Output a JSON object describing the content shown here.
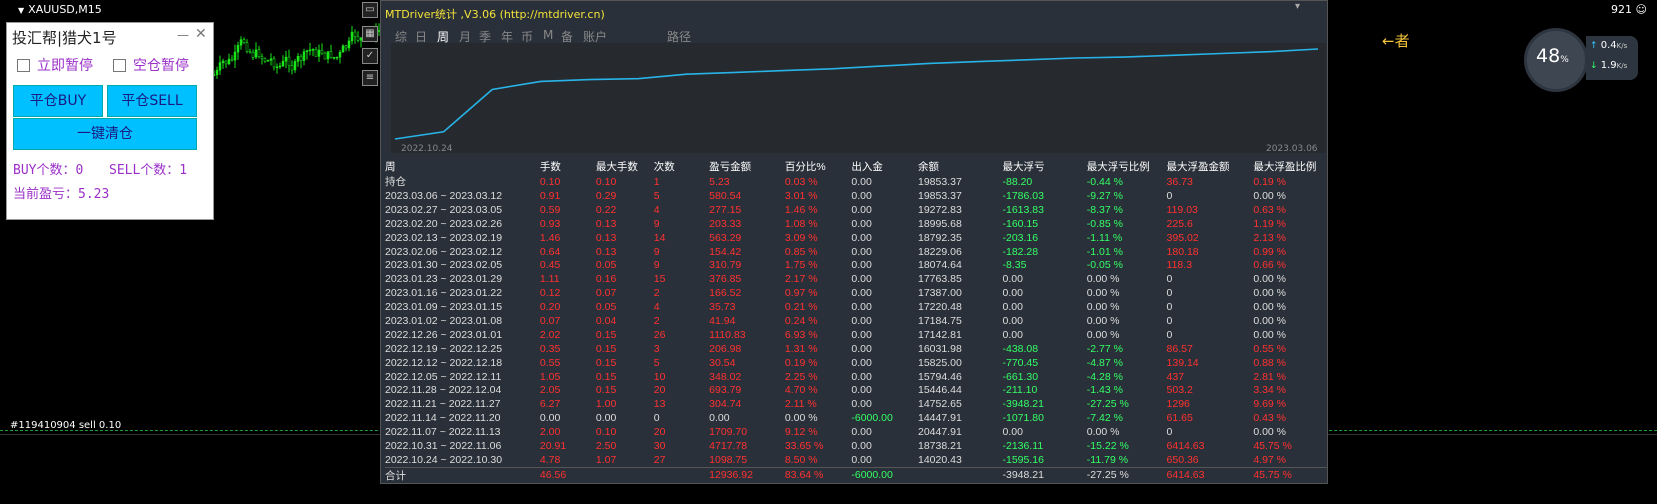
{
  "chart": {
    "symbol": "XAUUSD,M15",
    "order_label": "#119410904 sell 0.10",
    "score": "921"
  },
  "panel": {
    "title": "投汇帮|猎犬1号",
    "chk_pause_now": "立即暂停",
    "chk_pause_empty": "空仓暂停",
    "btn_close_buy": "平仓BUY",
    "btn_close_sell": "平仓SELL",
    "btn_close_all": "一键清仓",
    "buy_count_label": "BUY个数：0",
    "sell_count_label": "SELL个数：1",
    "profit_label": "当前盈亏：5.23"
  },
  "stats_window": {
    "title": "MTDriver统计 ,V3.06 (http://mtdriver.cn)",
    "tabs": [
      "综",
      "日",
      "周",
      "月",
      "季",
      "年",
      "币",
      "M",
      "备",
      "账户",
      "路径"
    ],
    "active_tab": "周",
    "date_start": "2022.10.24",
    "date_end": "2023.03.06",
    "equity_curve": [
      0.0,
      0.08,
      0.55,
      0.64,
      0.66,
      0.67,
      0.72,
      0.74,
      0.76,
      0.78,
      0.81,
      0.84,
      0.86,
      0.88,
      0.9,
      0.91,
      0.93,
      0.95,
      0.97,
      1.0
    ],
    "line_color": "#28b4e8",
    "headers": [
      "周",
      "手数",
      "最大手数",
      "次数",
      "盈亏金额",
      "百分比%",
      "出入金",
      "余额",
      "最大浮亏",
      "最大浮亏比例",
      "最大浮盈金额",
      "最大浮盈比例"
    ],
    "rows": [
      [
        "持仓",
        "0.10",
        "0.10",
        "1",
        "5.23",
        "0.03 %",
        "0.00",
        "19853.37",
        "-88.20",
        "-0.44 %",
        "36.73",
        "0.19 %"
      ],
      [
        "2023.03.06 ~ 2023.03.12",
        "0.91",
        "0.29",
        "5",
        "580.54",
        "3.01 %",
        "0.00",
        "19853.37",
        "-1786.03",
        "-9.27 %",
        "0",
        "0.00 %"
      ],
      [
        "2023.02.27 ~ 2023.03.05",
        "0.59",
        "0.22",
        "4",
        "277.15",
        "1.46 %",
        "0.00",
        "19272.83",
        "-1613.83",
        "-8.37 %",
        "119.03",
        "0.63 %"
      ],
      [
        "2023.02.20 ~ 2023.02.26",
        "0.93",
        "0.13",
        "9",
        "203.33",
        "1.08 %",
        "0.00",
        "18995.68",
        "-160.15",
        "-0.85 %",
        "225.6",
        "1.19 %"
      ],
      [
        "2023.02.13 ~ 2023.02.19",
        "1.46",
        "0.13",
        "14",
        "563.29",
        "3.09 %",
        "0.00",
        "18792.35",
        "-203.16",
        "-1.11 %",
        "395.02",
        "2.13 %"
      ],
      [
        "2023.02.06 ~ 2023.02.12",
        "0.64",
        "0.13",
        "9",
        "154.42",
        "0.85 %",
        "0.00",
        "18229.06",
        "-182.28",
        "-1.01 %",
        "180.18",
        "0.99 %"
      ],
      [
        "2023.01.30 ~ 2023.02.05",
        "0.45",
        "0.05",
        "9",
        "310.79",
        "1.75 %",
        "0.00",
        "18074.64",
        "-8.35",
        "-0.05 %",
        "118.3",
        "0.66 %"
      ],
      [
        "2023.01.23 ~ 2023.01.29",
        "1.11",
        "0.16",
        "15",
        "376.85",
        "2.17 %",
        "0.00",
        "17763.85",
        "0.00",
        "0.00 %",
        "0",
        "0.00 %"
      ],
      [
        "2023.01.16 ~ 2023.01.22",
        "0.12",
        "0.07",
        "2",
        "166.52",
        "0.97 %",
        "0.00",
        "17387.00",
        "0.00",
        "0.00 %",
        "0",
        "0.00 %"
      ],
      [
        "2023.01.09 ~ 2023.01.15",
        "0.20",
        "0.05",
        "4",
        "35.73",
        "0.21 %",
        "0.00",
        "17220.48",
        "0.00",
        "0.00 %",
        "0",
        "0.00 %"
      ],
      [
        "2023.01.02 ~ 2023.01.08",
        "0.07",
        "0.04",
        "2",
        "41.94",
        "0.24 %",
        "0.00",
        "17184.75",
        "0.00",
        "0.00 %",
        "0",
        "0.00 %"
      ],
      [
        "2022.12.26 ~ 2023.01.01",
        "2.02",
        "0.15",
        "26",
        "1110.83",
        "6.93 %",
        "0.00",
        "17142.81",
        "0.00",
        "0.00 %",
        "0",
        "0.00 %"
      ],
      [
        "2022.12.19 ~ 2022.12.25",
        "0.35",
        "0.15",
        "3",
        "206.98",
        "1.31 %",
        "0.00",
        "16031.98",
        "-438.08",
        "-2.77 %",
        "86.57",
        "0.55 %"
      ],
      [
        "2022.12.12 ~ 2022.12.18",
        "0.55",
        "0.15",
        "5",
        "30.54",
        "0.19 %",
        "0.00",
        "15825.00",
        "-770.45",
        "-4.87 %",
        "139.14",
        "0.88 %"
      ],
      [
        "2022.12.05 ~ 2022.12.11",
        "1.05",
        "0.15",
        "10",
        "348.02",
        "2.25 %",
        "0.00",
        "15794.46",
        "-661.30",
        "-4.28 %",
        "437",
        "2.81 %"
      ],
      [
        "2022.11.28 ~ 2022.12.04",
        "2.05",
        "0.15",
        "20",
        "693.79",
        "4.70 %",
        "0.00",
        "15446.44",
        "-211.10",
        "-1.43 %",
        "503.2",
        "3.34 %"
      ],
      [
        "2022.11.21 ~ 2022.11.27",
        "6.27",
        "1.00",
        "13",
        "304.74",
        "2.11 %",
        "0.00",
        "14752.65",
        "-3948.21",
        "-27.25 %",
        "1296",
        "9.69 %"
      ],
      [
        "2022.11.14 ~ 2022.11.20",
        "0.00",
        "0.00",
        "0",
        "0.00",
        "0.00 %",
        "-6000.00",
        "14447.91",
        "-1071.80",
        "-7.42 %",
        "61.65",
        "0.43 %"
      ],
      [
        "2022.11.07 ~ 2022.11.13",
        "2.00",
        "0.10",
        "20",
        "1709.70",
        "9.12 %",
        "0.00",
        "20447.91",
        "0.00",
        "0.00 %",
        "0",
        "0.00 %"
      ],
      [
        "2022.10.31 ~ 2022.11.06",
        "20.91",
        "2.50",
        "30",
        "4717.78",
        "33.65 %",
        "0.00",
        "18738.21",
        "-2136.11",
        "-15.22 %",
        "6414.63",
        "45.75 %"
      ],
      [
        "2022.10.24 ~ 2022.10.30",
        "4.78",
        "1.07",
        "27",
        "1098.75",
        "8.50 %",
        "0.00",
        "14020.43",
        "-1595.16",
        "-11.79 %",
        "650.36",
        "4.97 %"
      ]
    ],
    "total": [
      "合计",
      "46.56",
      "",
      "",
      "12936.92",
      "83.64 %",
      "-6000.00",
      "",
      "-3948.21",
      "-27.25 %",
      "6414.63",
      "45.75 %"
    ],
    "col_colors": [
      "w",
      "r",
      "r",
      "r",
      "r",
      "r",
      "w",
      "w",
      "g",
      "g",
      "r",
      "r"
    ]
  },
  "annotation": {
    "right_text": "←者"
  },
  "gauge": {
    "percent": "48",
    "percent_unit": "%",
    "up_speed": "0.4",
    "down_speed": "1.9",
    "unit": "K/s"
  }
}
